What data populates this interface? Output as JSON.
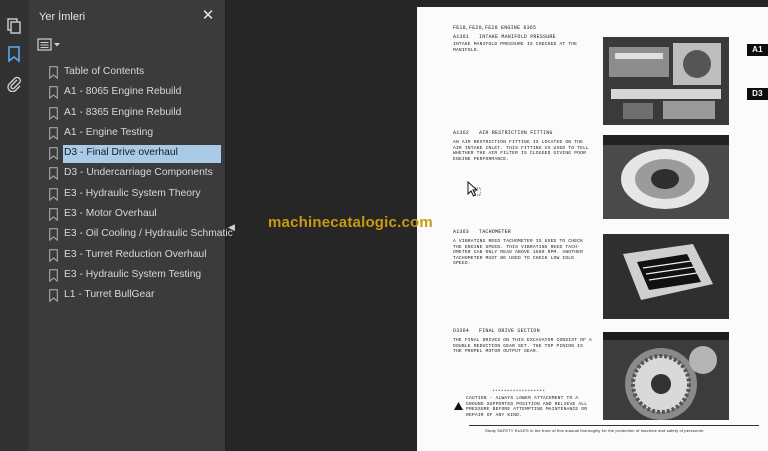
{
  "sidebar": {
    "title": "Yer İmleri",
    "close_glyph": "✕",
    "bookmarks": [
      {
        "label": "Table of Contents"
      },
      {
        "label": "A1 - 8065 Engine Rebuild"
      },
      {
        "label": "A1 - 8365 Engine Rebuild"
      },
      {
        "label": "A1 - Engine Testing"
      },
      {
        "label": "D3 - Final Drive overhaul",
        "selected": true
      },
      {
        "label": "D3 - Undercarriage Components"
      },
      {
        "label": "E3 - Hydraulic System Theory"
      },
      {
        "label": "E3 - Motor Overhaul"
      },
      {
        "label": "E3 - Oil Cooling / Hydraulic Schmatic"
      },
      {
        "label": "E3 - Turret Reduction Overhaul"
      },
      {
        "label": "E3 - Hydraulic System Testing"
      },
      {
        "label": "L1 - Turret BullGear"
      }
    ]
  },
  "rail": {
    "icons": [
      "copy-pages-icon",
      "bookmark-icon",
      "paperclip-icon"
    ]
  },
  "watermark": "machinecatalogic.com",
  "document": {
    "header": "FE18,FE20,FE28 ENGINE 8365",
    "tabs": [
      "A1",
      "D3"
    ],
    "sections": [
      {
        "code": "A1361",
        "title": "INTAKE MANIFOLD PRESSURE",
        "body": "INTAKE MANIFOLD PRESSURE IS CHECKED AT THE MANIFOLD."
      },
      {
        "code": "A1362",
        "title": "AIR RESTRICTION FITTING",
        "body": "AN AIR RESTRICTION FITTING IS LOCATED ON THE AIR INTAKE INLET. THIS FITTING IS USED TO TELL WHETHER THE AIR FILTER IS CLOGGED GIVING POOR ENGINE PERFORMANCE."
      },
      {
        "code": "A1363",
        "title": "TACHOMETER",
        "body": "A VIBRATING REED TACHOMETER IS USED TO CHECK THE ENGINE SPEED. THIS VIBRATING REED TACH-OMETER CAN ONLY READ ABOVE 1600 RPM. ANOTHER TACHOMETER MUST BE USED TO CHECK LOW IDLE SPEED."
      },
      {
        "code": "D3364",
        "title": "FINAL DRIVE SECTION",
        "body": "THE FINAL DRIVES ON THIS EXCAVATOR CONSIST OF A DOUBLE REDUCTION GEAR SET. THE TOP PINION IS THE PROPEL MOTOR OUTPUT GEAR."
      }
    ],
    "stars": "******************",
    "caution": "CAUTION - ALWAYS LOWER ATTACHMENT TO A GROUND SUPPORTED POSITION AND RELIEVE ALL PRESSURE BEFORE ATTEMPTING MAINTENANCE OR REPAIR OF ANY KIND.",
    "footer": "Study SAFETY RULES in the front of this manual thoroughly for the protection of machine and safety of personnel."
  }
}
